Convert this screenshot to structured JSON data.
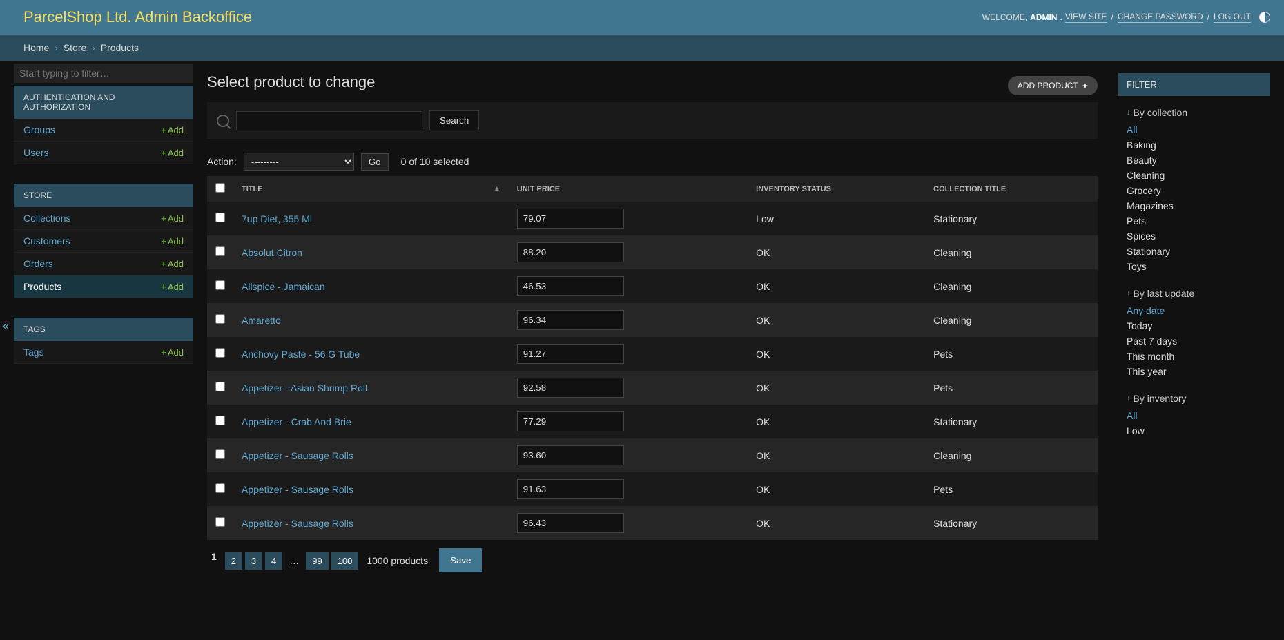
{
  "brand": "ParcelShop Ltd. Admin Backoffice",
  "user_tools": {
    "welcome": "WELCOME,",
    "username": "ADMIN",
    "view_site": "VIEW SITE",
    "change_password": "CHANGE PASSWORD",
    "log_out": "LOG OUT"
  },
  "breadcrumbs": {
    "home": "Home",
    "store": "Store",
    "products": "Products"
  },
  "sidebar": {
    "filter_placeholder": "Start typing to filter…",
    "add_label": "Add",
    "sections": [
      {
        "title": "AUTHENTICATION AND AUTHORIZATION",
        "items": [
          {
            "label": "Groups"
          },
          {
            "label": "Users"
          }
        ]
      },
      {
        "title": "STORE",
        "items": [
          {
            "label": "Collections"
          },
          {
            "label": "Customers"
          },
          {
            "label": "Orders"
          },
          {
            "label": "Products",
            "active": true
          }
        ]
      },
      {
        "title": "TAGS",
        "items": [
          {
            "label": "Tags"
          }
        ]
      }
    ]
  },
  "page_title": "Select product to change",
  "add_product": "ADD PRODUCT",
  "searchbar": {
    "button": "Search"
  },
  "actions": {
    "label": "Action:",
    "placeholder": "---------",
    "go": "Go",
    "selection_count": "0 of 10 selected"
  },
  "table": {
    "headers": {
      "title": "TITLE",
      "unit_price": "UNIT PRICE",
      "inventory_status": "INVENTORY STATUS",
      "collection_title": "COLLECTION TITLE"
    },
    "rows": [
      {
        "title": "7up Diet, 355 Ml",
        "unit_price": "79.07",
        "inventory": "Low",
        "collection": "Stationary"
      },
      {
        "title": "Absolut Citron",
        "unit_price": "88.20",
        "inventory": "OK",
        "collection": "Cleaning"
      },
      {
        "title": "Allspice - Jamaican",
        "unit_price": "46.53",
        "inventory": "OK",
        "collection": "Cleaning"
      },
      {
        "title": "Amaretto",
        "unit_price": "96.34",
        "inventory": "OK",
        "collection": "Cleaning"
      },
      {
        "title": "Anchovy Paste - 56 G Tube",
        "unit_price": "91.27",
        "inventory": "OK",
        "collection": "Pets"
      },
      {
        "title": "Appetizer - Asian Shrimp Roll",
        "unit_price": "92.58",
        "inventory": "OK",
        "collection": "Pets"
      },
      {
        "title": "Appetizer - Crab And Brie",
        "unit_price": "77.29",
        "inventory": "OK",
        "collection": "Stationary"
      },
      {
        "title": "Appetizer - Sausage Rolls",
        "unit_price": "93.60",
        "inventory": "OK",
        "collection": "Cleaning"
      },
      {
        "title": "Appetizer - Sausage Rolls",
        "unit_price": "91.63",
        "inventory": "OK",
        "collection": "Pets"
      },
      {
        "title": "Appetizer - Sausage Rolls",
        "unit_price": "96.43",
        "inventory": "OK",
        "collection": "Stationary"
      }
    ]
  },
  "paginator": {
    "current": "1",
    "pages": [
      "2",
      "3",
      "4"
    ],
    "ellipsis": "…",
    "last_pages": [
      "99",
      "100"
    ],
    "total": "1000 products",
    "save": "Save"
  },
  "filters": {
    "header": "FILTER",
    "groups": [
      {
        "title": "By collection",
        "items": [
          "All",
          "Baking",
          "Beauty",
          "Cleaning",
          "Grocery",
          "Magazines",
          "Pets",
          "Spices",
          "Stationary",
          "Toys"
        ],
        "selected": "All"
      },
      {
        "title": "By last update",
        "items": [
          "Any date",
          "Today",
          "Past 7 days",
          "This month",
          "This year"
        ],
        "selected": "Any date"
      },
      {
        "title": "By inventory",
        "items": [
          "All",
          "Low"
        ],
        "selected": "All"
      }
    ]
  }
}
